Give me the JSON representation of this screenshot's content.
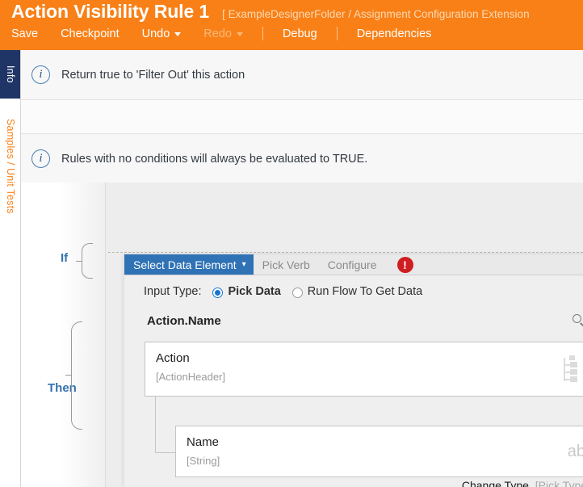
{
  "header": {
    "title": "Action Visibility Rule 1",
    "breadcrumb": "[ ExampleDesignerFolder / Assignment Configuration Extension",
    "brand_color": "#f88017",
    "menu": [
      {
        "label": "Save",
        "disabled": false,
        "caret": false
      },
      {
        "label": "Checkpoint",
        "disabled": false,
        "caret": false
      },
      {
        "label": "Undo",
        "disabled": false,
        "caret": true
      },
      {
        "label": "Redo",
        "disabled": true,
        "caret": true
      },
      {
        "label": "Debug",
        "disabled": false,
        "caret": false
      },
      {
        "label": "Dependencies",
        "disabled": false,
        "caret": false
      }
    ]
  },
  "rail": {
    "tabs": [
      {
        "label": "Info",
        "active": true
      },
      {
        "label": "Samples / Unit Tests",
        "active": false
      }
    ],
    "active_color": "#1f3566",
    "inactive_text_color": "#f88017"
  },
  "banners": [
    {
      "icon": "info-icon",
      "text": "Return true to 'Filter Out' this action"
    },
    {
      "icon": "info-icon",
      "text": "Rules with no conditions will always be evaluated to TRUE."
    }
  ],
  "rule": {
    "if_label": "If",
    "then_label": "Then"
  },
  "panel": {
    "tabs": [
      {
        "label": "Select Data Element",
        "active": true,
        "caret": "▾"
      },
      {
        "label": "Pick Verb",
        "active": false,
        "caret": ""
      },
      {
        "label": "Configure",
        "active": false,
        "caret": ""
      }
    ],
    "error_badge": "!",
    "error_color": "#cf1e22",
    "active_tab_color": "#2f72b5",
    "input_type": {
      "label": "Input Type:",
      "options": [
        {
          "label": "Pick Data",
          "selected": true
        },
        {
          "label": "Run Flow To Get Data",
          "selected": false
        }
      ]
    },
    "path": "Action.Name",
    "search_icon": "search-icon",
    "cards": [
      {
        "title": "Action",
        "subtitle": "[ActionHeader]",
        "type_icon": "tree-icon",
        "close": "×"
      },
      {
        "title": "Name",
        "subtitle": "[String]",
        "type_icon": "abc-icon",
        "type_icon_text": "abc",
        "close": "×"
      }
    ],
    "change_type": {
      "link": "Change Type",
      "hint": "[Pick Type]"
    }
  }
}
